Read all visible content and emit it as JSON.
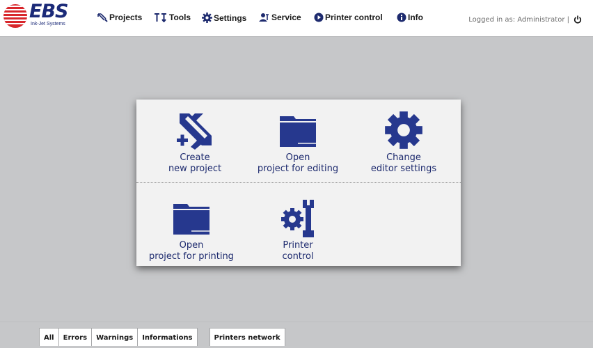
{
  "header": {
    "logo_text": "EBS",
    "logo_subtitle": "Ink-Jet Systems",
    "nav": [
      {
        "label": "Projects",
        "icon": "projects-icon"
      },
      {
        "label": "Tools",
        "icon": "tools-icon"
      },
      {
        "label": "Settings",
        "icon": "gear-icon"
      },
      {
        "label": "Service",
        "icon": "service-icon"
      },
      {
        "label": "Printer control",
        "icon": "printer-control-icon"
      },
      {
        "label": "Info",
        "icon": "info-icon"
      }
    ],
    "login_text": "Logged in as: Administrator |"
  },
  "panel": {
    "tiles": [
      {
        "label": "Create\nnew project",
        "icon": "create-project-icon"
      },
      {
        "label": "Open\nproject for editing",
        "icon": "folder-icon"
      },
      {
        "label": "Change\neditor settings",
        "icon": "gear-icon"
      },
      {
        "label": "Open\nproject for printing",
        "icon": "folder-icon"
      },
      {
        "label": "Printer\ncontrol",
        "icon": "printer-control-icon"
      }
    ]
  },
  "bottom_tabs": [
    "All",
    "Errors",
    "Warnings",
    "Informations"
  ],
  "network_tab": "Printers network",
  "colors": {
    "accent": "#26388e",
    "background": "#c6c7c9",
    "logo_red": "#d8262b"
  }
}
